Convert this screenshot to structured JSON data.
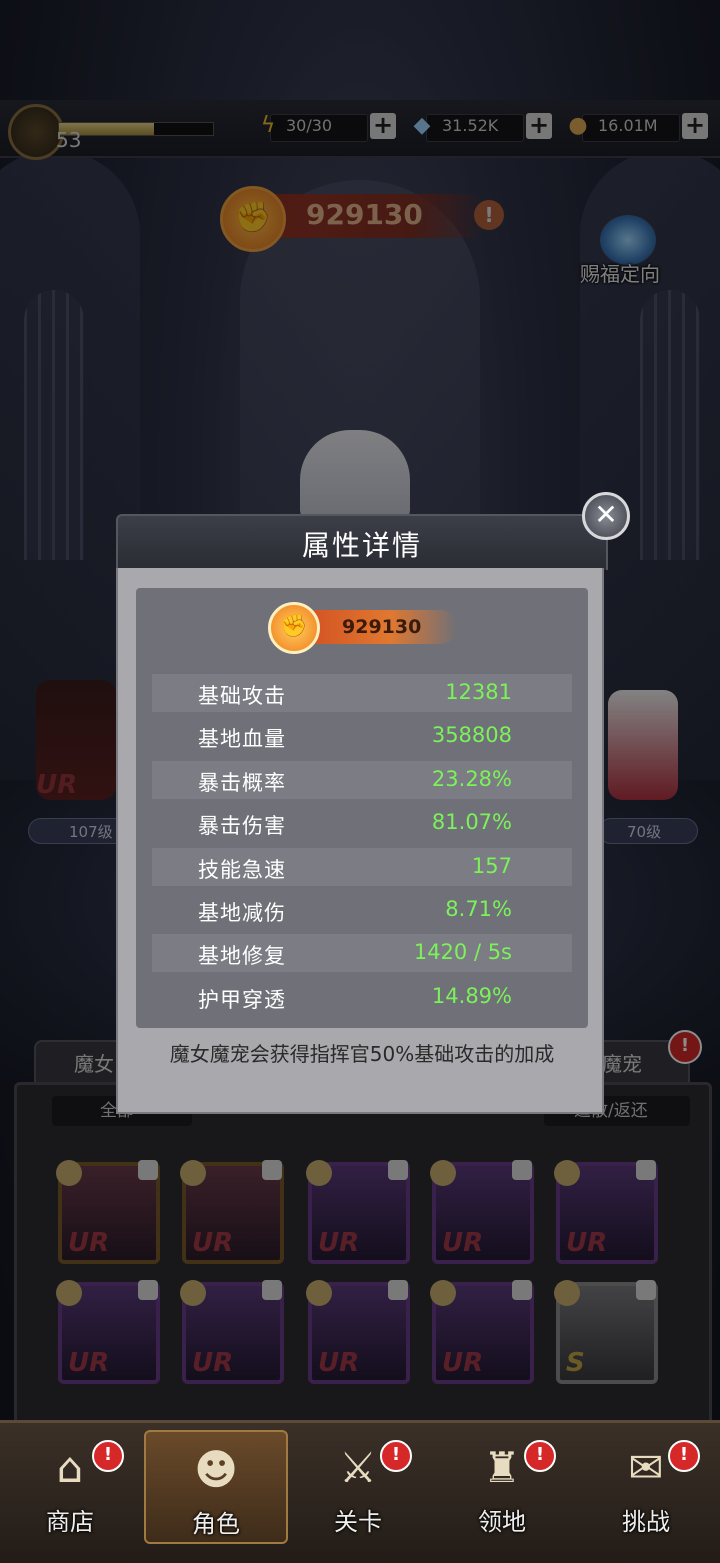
{
  "top_bar": {
    "level": "53",
    "xp_fraction": 0.62,
    "energy": "30/30",
    "gems": "31.52K",
    "gold": "16.01M",
    "plus": "+"
  },
  "power": {
    "value": "929130",
    "info_icon": "!"
  },
  "blessing": {
    "label": "赐福定向"
  },
  "background": {
    "left_char_rank": "UR",
    "left_char_level": "107级",
    "right_char_level": "70级",
    "tab_left": "魔女",
    "tab_right": "魔宠",
    "tab_alert": "!",
    "filter_left": "全部",
    "filter_right": "遣散/返还",
    "grid_row1": [
      "UR",
      "UR",
      "UR",
      "UR",
      "UR"
    ],
    "grid_row2": [
      "UR",
      "UR",
      "UR",
      "UR",
      "S"
    ]
  },
  "modal": {
    "title": "属性详情",
    "power": "929130",
    "stats": [
      {
        "label": "基础攻击",
        "value": "12381"
      },
      {
        "label": "基地血量",
        "value": "358808"
      },
      {
        "label": "暴击概率",
        "value": "23.28%"
      },
      {
        "label": "暴击伤害",
        "value": "81.07%"
      },
      {
        "label": "技能急速",
        "value": "157"
      },
      {
        "label": "基地减伤",
        "value": "8.71%"
      },
      {
        "label": "基地修复",
        "value": "1420 / 5s"
      },
      {
        "label": "护甲穿透",
        "value": "14.89%"
      }
    ],
    "note": "魔女魔宠会获得指挥官50%基础攻击的加成",
    "close": "✕"
  },
  "nav": {
    "items": [
      {
        "label": "商店",
        "icon": "shop-icon",
        "alert": "!"
      },
      {
        "label": "角色",
        "icon": "character-icon",
        "alert": ""
      },
      {
        "label": "关卡",
        "icon": "swords-icon",
        "alert": "!"
      },
      {
        "label": "领地",
        "icon": "castle-icon",
        "alert": "!"
      },
      {
        "label": "挑战",
        "icon": "scroll-icon",
        "alert": "!"
      }
    ]
  },
  "colors": {
    "stat_value": "#7cf25a",
    "alert": "#d62828"
  }
}
